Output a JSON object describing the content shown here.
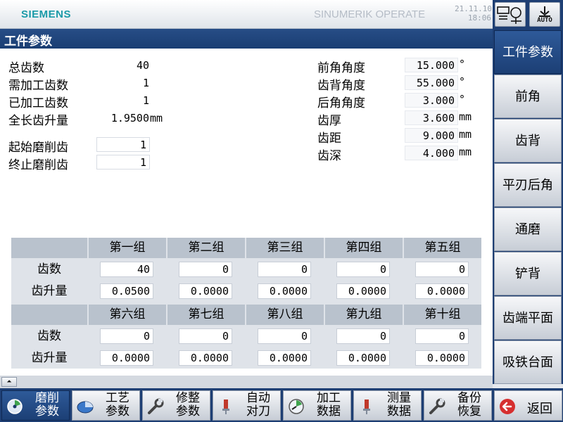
{
  "header": {
    "brand": "SIEMENS",
    "hmi_title": "SINUMERIK OPERATE",
    "date": "21.11.10",
    "time": "18:06",
    "mode_label": "AUTO"
  },
  "page": {
    "title": "工件参数"
  },
  "left_params": [
    {
      "label": "总齿数",
      "value": "40"
    },
    {
      "label": "需加工齿数",
      "value": "1"
    },
    {
      "label": "已加工齿数",
      "value": "1"
    },
    {
      "label": "全长齿升量",
      "value": "1.9500",
      "unit": "mm"
    }
  ],
  "grind_range": [
    {
      "label": "起始磨削齿",
      "value": "1"
    },
    {
      "label": "终止磨削齿",
      "value": "1"
    }
  ],
  "right_params": [
    {
      "label": "前角角度",
      "value": "15.000",
      "unit": "°"
    },
    {
      "label": "齿背角度",
      "value": "55.000",
      "unit": "°"
    },
    {
      "label": "后角角度",
      "value": "3.000",
      "unit": "°"
    },
    {
      "label": "齿厚",
      "value": "3.600",
      "unit": "mm"
    },
    {
      "label": "齿距",
      "value": "9.000",
      "unit": "mm"
    },
    {
      "label": "齿深",
      "value": "4.000",
      "unit": "mm"
    }
  ],
  "groups_table": {
    "row_labels": [
      "齿数",
      "齿升量"
    ],
    "block1": {
      "headers": [
        "第一组",
        "第二组",
        "第三组",
        "第四组",
        "第五组"
      ],
      "teeth": [
        "40",
        "0",
        "0",
        "0",
        "0"
      ],
      "rise": [
        "0.0500",
        "0.0000",
        "0.0000",
        "0.0000",
        "0.0000"
      ]
    },
    "block2": {
      "headers": [
        "第六组",
        "第七组",
        "第八组",
        "第九组",
        "第十组"
      ],
      "teeth": [
        "0",
        "0",
        "0",
        "0",
        "0"
      ],
      "rise": [
        "0.0000",
        "0.0000",
        "0.0000",
        "0.0000",
        "0.0000"
      ]
    }
  },
  "vertical_softkeys": [
    "工件参数",
    "前角",
    "齿背",
    "平刃后角",
    "通磨",
    "铲背",
    "齿端平面",
    "吸铁台面"
  ],
  "horizontal_softkeys": [
    {
      "l1": "磨削",
      "l2": "参数",
      "icon": "grinding-icon"
    },
    {
      "l1": "工艺",
      "l2": "参数",
      "icon": "pie-chart-icon"
    },
    {
      "l1": "修整",
      "l2": "参数",
      "icon": "wrench-icon"
    },
    {
      "l1": "自动",
      "l2": "对刀",
      "icon": "probe-icon"
    },
    {
      "l1": "加工",
      "l2": "数据",
      "icon": "gauge-icon"
    },
    {
      "l1": "测量",
      "l2": "数据",
      "icon": "probe-icon"
    },
    {
      "l1": "备份",
      "l2": "恢复",
      "icon": "wrench-icon"
    }
  ],
  "back_button": {
    "label": "返回",
    "icon": "back-arrow-icon"
  },
  "scroll_up": {
    "glyph": "⏶"
  }
}
